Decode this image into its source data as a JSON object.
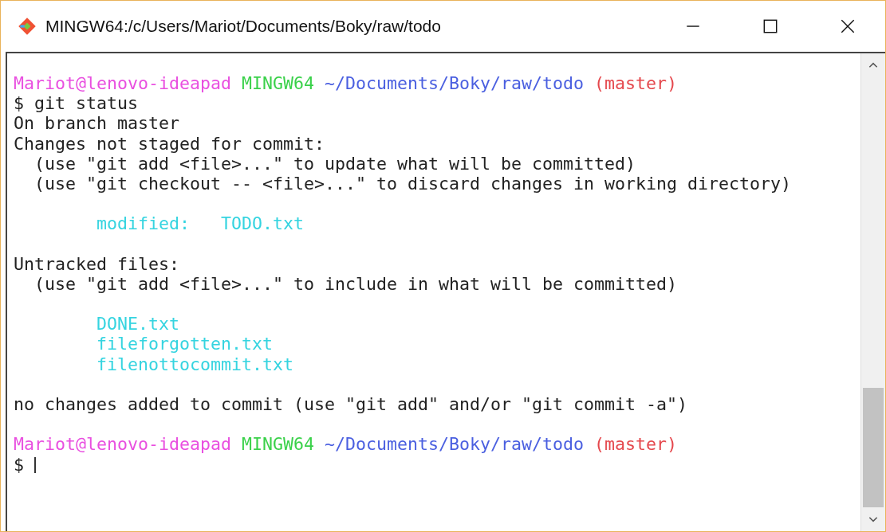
{
  "window": {
    "title": "MINGW64:/c/Users/Mariot/Documents/Boky/raw/todo"
  },
  "terminal": {
    "lines": [
      {
        "kind": "prompt",
        "user": "Mariot@lenovo-ideapad",
        "host": "MINGW64",
        "path": "~/Documents/Boky/raw/todo",
        "branch": "(master)"
      },
      {
        "kind": "output",
        "text": "$ git status"
      },
      {
        "kind": "output",
        "text": "On branch master"
      },
      {
        "kind": "output",
        "text": "Changes not staged for commit:"
      },
      {
        "kind": "output",
        "text": "  (use \"git add <file>...\" to update what will be committed)"
      },
      {
        "kind": "output",
        "text": "  (use \"git checkout -- <file>...\" to discard changes in working directory)"
      },
      {
        "kind": "blank"
      },
      {
        "kind": "file",
        "text": "        modified:   TODO.txt"
      },
      {
        "kind": "blank"
      },
      {
        "kind": "output",
        "text": "Untracked files:"
      },
      {
        "kind": "output",
        "text": "  (use \"git add <file>...\" to include in what will be committed)"
      },
      {
        "kind": "blank"
      },
      {
        "kind": "file",
        "text": "        DONE.txt"
      },
      {
        "kind": "file",
        "text": "        fileforgotten.txt"
      },
      {
        "kind": "file",
        "text": "        filenottocommit.txt"
      },
      {
        "kind": "blank"
      },
      {
        "kind": "output",
        "text": "no changes added to commit (use \"git add\" and/or \"git commit -a\")"
      },
      {
        "kind": "blank"
      },
      {
        "kind": "prompt",
        "user": "Mariot@lenovo-ideapad",
        "host": "MINGW64",
        "path": "~/Documents/Boky/raw/todo",
        "branch": "(master)"
      },
      {
        "kind": "input",
        "text": "$"
      }
    ]
  }
}
